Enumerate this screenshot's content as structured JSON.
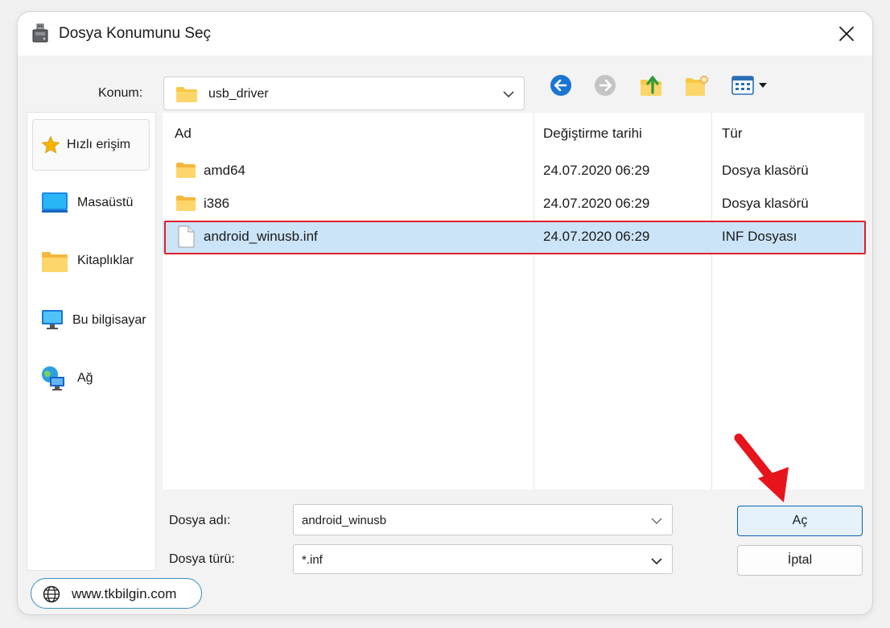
{
  "window": {
    "title": "Dosya Konumunu Seç"
  },
  "toolbar": {
    "location_label": "Konum:",
    "location_value": "usb_driver",
    "buttons": [
      "back-icon",
      "forward-icon",
      "up-folder-icon",
      "new-folder-icon",
      "view-menu-icon"
    ]
  },
  "sidebar": {
    "items": [
      {
        "label": "Hızlı erişim",
        "icon": "star-icon"
      },
      {
        "label": "Masaüstü",
        "icon": "desktop-icon"
      },
      {
        "label": "Kitaplıklar",
        "icon": "libraries-icon"
      },
      {
        "label": "Bu bilgisayar",
        "icon": "computer-icon"
      },
      {
        "label": "Ağ",
        "icon": "network-icon"
      }
    ]
  },
  "filelist": {
    "columns": [
      "Ad",
      "Değiştirme tarihi",
      "Tür"
    ],
    "rows": [
      {
        "name": "amd64",
        "date": "24.07.2020 06:29",
        "type": "Dosya klasörü",
        "icon": "folder-icon"
      },
      {
        "name": "i386",
        "date": "24.07.2020 06:29",
        "type": "Dosya klasörü",
        "icon": "folder-icon"
      },
      {
        "name": "android_winusb.inf",
        "date": "24.07.2020 06:29",
        "type": "INF Dosyası",
        "icon": "file-icon",
        "selected": true
      }
    ]
  },
  "footer": {
    "filename_label": "Dosya adı:",
    "filename_value": "android_winusb",
    "filetype_label": "Dosya türü:",
    "filetype_value": "*.inf",
    "open_button": "Aç",
    "cancel_button": "İptal"
  },
  "watermark": {
    "text": "www.tkbilgin.com"
  },
  "colors": {
    "selection": "#cce4f7",
    "highlight_border": "#e0202a",
    "primary_border": "#0a63b8",
    "arrow": "#e8141c"
  }
}
